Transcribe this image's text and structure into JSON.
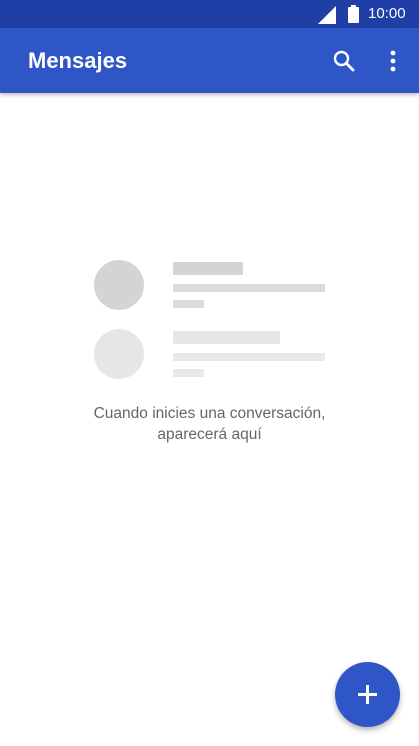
{
  "status_bar": {
    "time": "10:00",
    "icons": [
      "signal-icon",
      "battery-icon"
    ]
  },
  "app_bar": {
    "title": "Mensajes",
    "actions": [
      "search-icon",
      "more-vert-icon"
    ]
  },
  "empty_state": {
    "line1": "Cuando inicies una conversación,",
    "line2": "aparecerá aquí"
  },
  "fab": {
    "icon": "plus-icon"
  },
  "colors": {
    "status_bar": "#1f3fa6",
    "app_bar": "#2e56c7",
    "accent": "#2e56c7",
    "placeholder_dark": "#d4d4d4",
    "placeholder_light": "#e6e6e6"
  }
}
